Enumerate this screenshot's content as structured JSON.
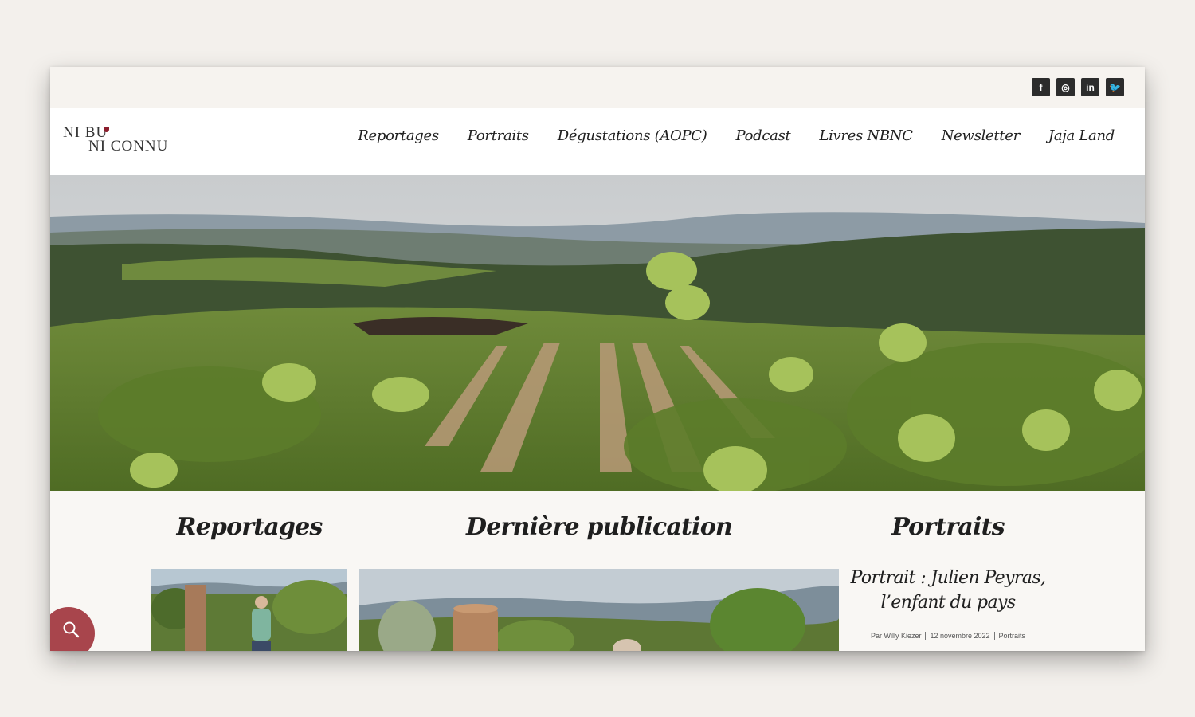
{
  "logo": {
    "line1": "NI BU",
    "line2": "NI CONNU"
  },
  "social": [
    {
      "icon": "facebook-icon",
      "glyph": "f"
    },
    {
      "icon": "instagram-icon",
      "glyph": "◎"
    },
    {
      "icon": "linkedin-icon",
      "glyph": "in"
    },
    {
      "icon": "twitter-icon",
      "glyph": "🐦"
    }
  ],
  "nav": {
    "items": [
      "Reportages",
      "Portraits",
      "Dégustations (AOPC)",
      "Podcast",
      "Livres NBNC",
      "Newsletter",
      "Jaja Land"
    ]
  },
  "sections": {
    "reportages": "Reportages",
    "latest": "Dernière publication",
    "portraits": "Portraits"
  },
  "portrait": {
    "title": "Portrait : Julien Peyras, l’enfant du pays",
    "author": "Par Willy Kiezer",
    "date": "12 novembre 2022",
    "category": "Portraits"
  },
  "colors": {
    "accent": "#a8454c",
    "wine": "#8b1d2c"
  }
}
